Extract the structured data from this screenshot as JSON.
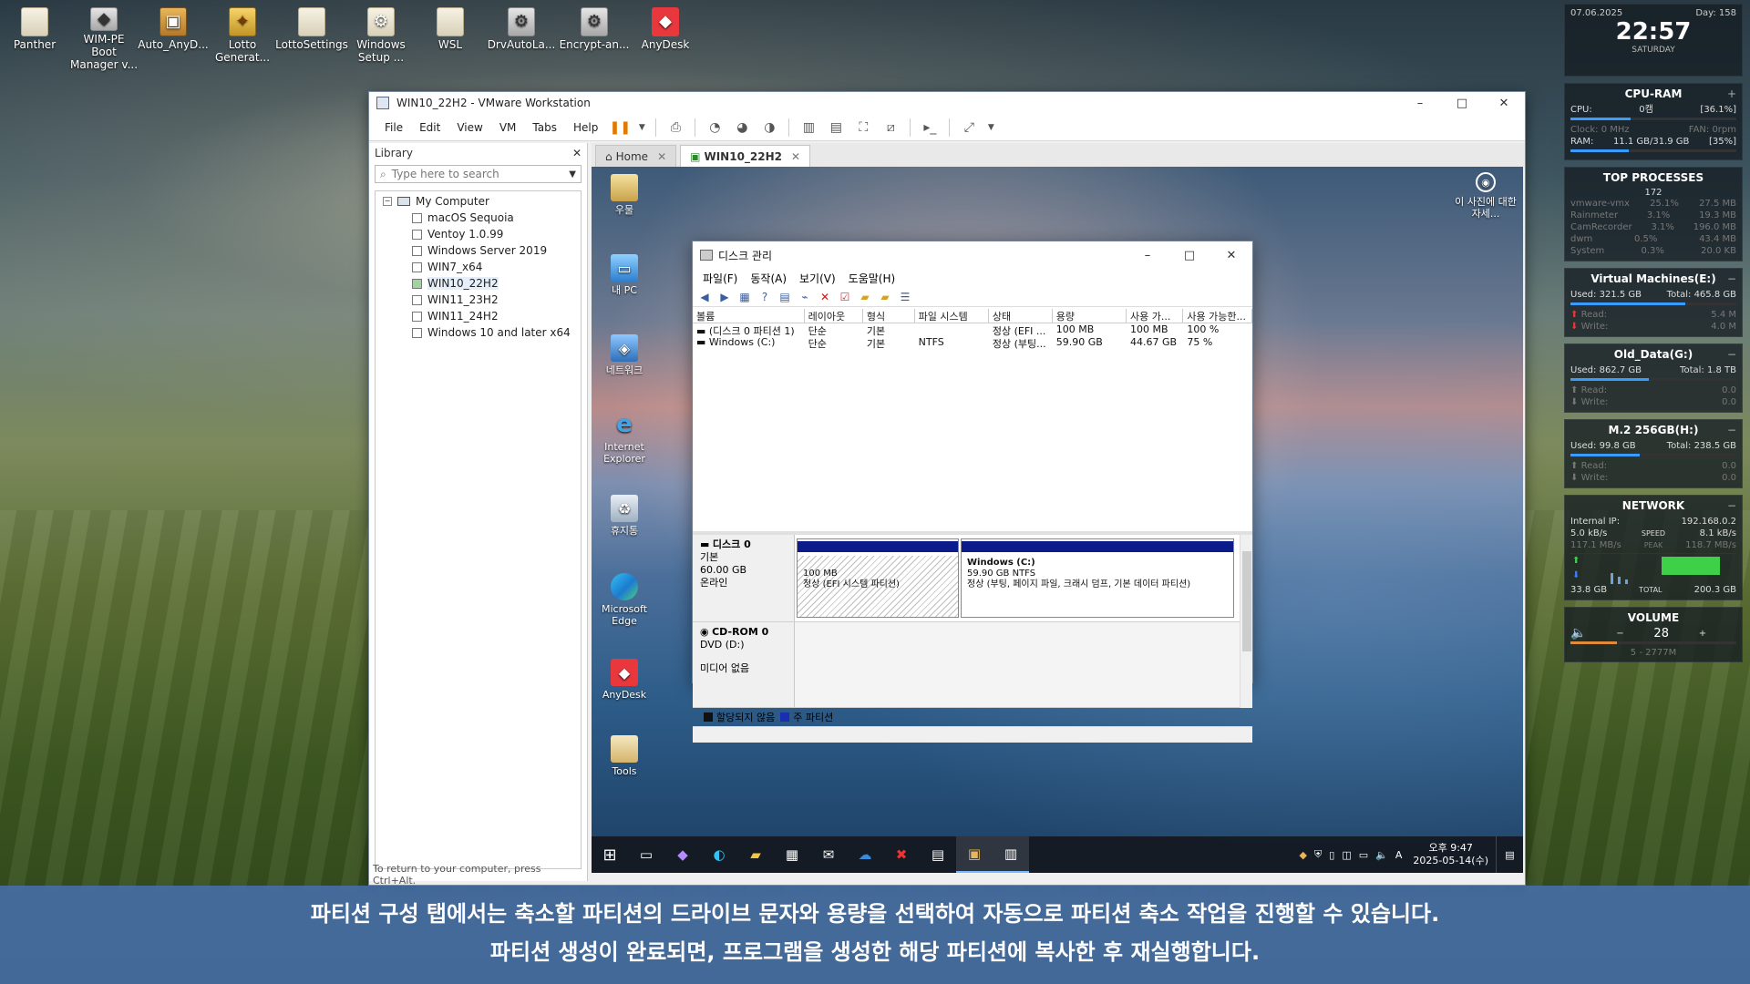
{
  "desktop_icons": [
    {
      "label": "Panther",
      "icon": "folder-icon"
    },
    {
      "label": "WIM-PE Boot Manager v...",
      "icon": "gear-icon"
    },
    {
      "label": "Auto_AnyD...",
      "icon": "box-icon"
    },
    {
      "label": "Lotto Generat...",
      "icon": "gold-icon"
    },
    {
      "label": "LottoSettings",
      "icon": "folder-icon"
    },
    {
      "label": "Windows Setup ...",
      "icon": "setup-icon"
    },
    {
      "label": "WSL",
      "icon": "folder-icon"
    },
    {
      "label": "DrvAutoLa...",
      "icon": "gear-icon"
    },
    {
      "label": "Encrypt-an...",
      "icon": "gear-icon"
    },
    {
      "label": "AnyDesk",
      "icon": "anydesk-icon"
    }
  ],
  "vmware": {
    "title": "WIN10_22H2 - VMware Workstation",
    "menu": [
      "File",
      "Edit",
      "View",
      "VM",
      "Tabs",
      "Help"
    ],
    "library_title": "Library",
    "search_placeholder": "Type here to search",
    "tree_root": "My Computer",
    "vms": [
      "macOS Sequoia",
      "Ventoy 1.0.99",
      "Windows Server 2019",
      "WIN7_x64",
      "WIN10_22H2",
      "WIN11_23H2",
      "WIN11_24H2",
      "Windows 10 and later x64"
    ],
    "selected_vm": "WIN10_22H2",
    "tabs": [
      "Home",
      "WIN10_22H2"
    ],
    "footer": "To return to your computer, press Ctrl+Alt."
  },
  "guest": {
    "desktop_icons": [
      "우물",
      "내 PC",
      "네트워크",
      "Internet Explorer",
      "휴지통",
      "Microsoft Edge",
      "AnyDesk",
      "Tools"
    ],
    "learn_text": "이 사진에 대한 자세...",
    "taskbar": {
      "time": "오후 9:47",
      "date": "2025-05-14(수)",
      "ime": "A"
    }
  },
  "disk_mgmt": {
    "title": "디스크 관리",
    "menu": [
      "파일(F)",
      "동작(A)",
      "보기(V)",
      "도움말(H)"
    ],
    "columns": [
      "볼륨",
      "레이아웃",
      "형식",
      "파일 시스템",
      "상태",
      "용량",
      "사용 가...",
      "사용 가능한..."
    ],
    "volumes": [
      [
        "(디스크 0 파티션 1)",
        "단순",
        "기본",
        "",
        "정상 (EFI ...",
        "100 MB",
        "100 MB",
        "100 %"
      ],
      [
        "Windows (C:)",
        "단순",
        "기본",
        "NTFS",
        "정상 (부팅...",
        "59.90 GB",
        "44.67 GB",
        "75 %"
      ]
    ],
    "disk0": {
      "name": "디스크 0",
      "type": "기본",
      "size": "60.00 GB",
      "status": "온라인"
    },
    "efi_part": {
      "size": "100 MB",
      "status": "정상 (EFI 시스템 파티션)"
    },
    "c_part": {
      "name": "Windows  (C:)",
      "size": "59.90 GB NTFS",
      "status": "정상 (부팅, 페이지 파일, 크래시 덤프, 기본 데이터 파티션)"
    },
    "cdrom": {
      "name": "CD-ROM 0",
      "drive": "DVD (D:)",
      "media": "미디어 없음"
    },
    "legend": [
      {
        "label": "할당되지 않음",
        "color": "#111111"
      },
      {
        "label": "주 파티션",
        "color": "#1a2fb0"
      }
    ]
  },
  "subtitle": {
    "line1": "파티션 구성 탭에서는 축소할 파티션의 드라이브 문자와 용량을 선택하여 자동으로 파티션 축소 작업을 진행할 수 있습니다.",
    "line2": "파티션 생성이 완료되면, 프로그램을 생성한 해당 파티션에 복사한 후 재실행합니다."
  },
  "widgets": {
    "clock": {
      "date": "07.06.2025",
      "day_num": "Day: 158",
      "time": "22:57",
      "weekday": "SATURDAY"
    },
    "cpu": {
      "title": "CPU-RAM",
      "cpu_label": "CPU:",
      "cpu_temp": "0캠",
      "cpu_pct": "[36.1%]",
      "clock": "Clock: 0 MHz",
      "fan": "FAN: 0rpm",
      "ram_label": "RAM:",
      "ram_val": "11.1 GB/31.9 GB",
      "ram_pct": "[35%]",
      "cpu_fill": 0.361,
      "ram_fill": 0.35
    },
    "top": {
      "title": "TOP PROCESSES",
      "count": "172",
      "rows": [
        [
          "vmware-vmx",
          "25.1%",
          "27.5 MB"
        ],
        [
          "Rainmeter",
          "3.1%",
          "19.3 MB"
        ],
        [
          "CamRecorder",
          "3.1%",
          "196.0 MB"
        ],
        [
          "dwm",
          "0.5%",
          "43.4 MB"
        ],
        [
          "System",
          "0.3%",
          "20.0 KB"
        ]
      ]
    },
    "drives": [
      {
        "title": "Virtual Machines(E:)",
        "used": "Used: 321.5 GB",
        "total": "Total: 465.8 GB",
        "read": "Read:",
        "read_val": "5.4 M",
        "write": "Write:",
        "write_val": "4.0 M",
        "fill": 0.69
      },
      {
        "title": "Old_Data(G:)",
        "used": "Used: 862.7 GB",
        "total": "Total: 1.8 TB",
        "read": "Read:",
        "read_val": "0.0",
        "write": "Write:",
        "write_val": "0.0",
        "fill": 0.47
      },
      {
        "title": "M.2 256GB(H:)",
        "used": "Used: 99.8 GB",
        "total": "Total: 238.5 GB",
        "read": "Read:",
        "read_val": "0.0",
        "write": "Write:",
        "write_val": "0.0",
        "fill": 0.42
      }
    ],
    "network": {
      "title": "NETWORK",
      "ip_label": "Internal IP:",
      "ip": "192.168.0.2",
      "down_speed": "5.0 kB/s",
      "speed_label": "SPEED",
      "up_speed": "8.1 kB/s",
      "down_peak": "117.1 MB/s",
      "peak_label": "PEAK",
      "up_peak": "118.7 MB/s",
      "down_total": "33.8 GB",
      "total_label": "TOTAL",
      "up_total": "200.3 GB"
    },
    "volume": {
      "title": "VOLUME",
      "level": "28",
      "device": "5 - 2777M"
    }
  },
  "colors": {
    "accent": "#3a9cff",
    "partition": "#0b1c8a",
    "subtitle_bg": "#466eaa"
  }
}
